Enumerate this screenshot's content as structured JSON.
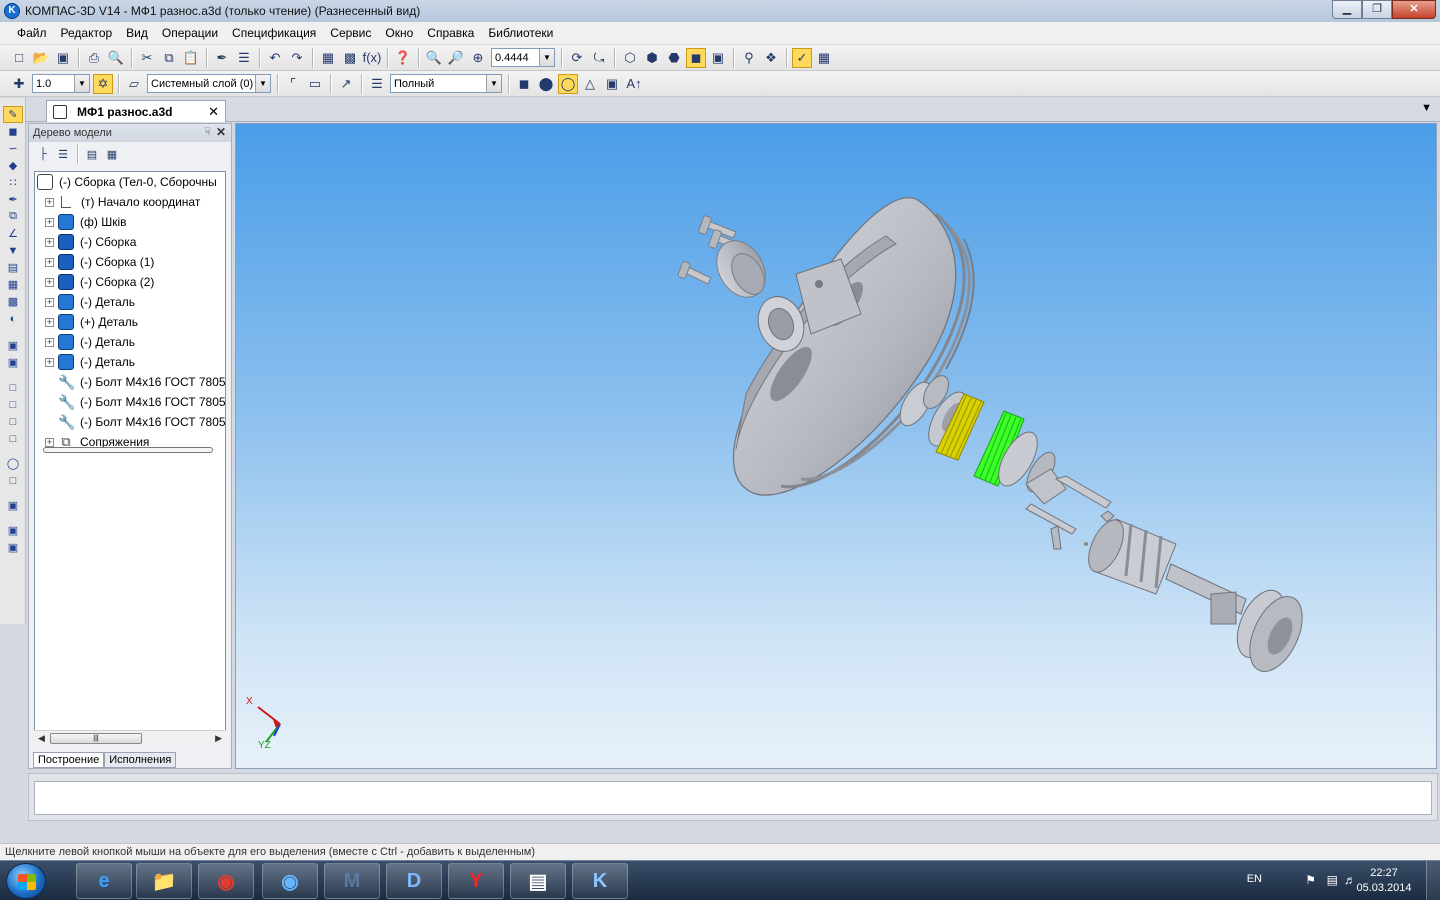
{
  "window": {
    "app_icon": "kompas-logo-icon",
    "title": "КОМПАС-3D V14 - МФ1 разнос.a3d (только чтение) (Разнесенный вид)",
    "controls": [
      "minimize-icon",
      "restore-icon",
      "close-icon"
    ]
  },
  "menubar": [
    "Файл",
    "Редактор",
    "Вид",
    "Операции",
    "Спецификация",
    "Сервис",
    "Окно",
    "Справка",
    "Библиотеки"
  ],
  "toolbar1": {
    "zoom_value": "0.4444"
  },
  "toolbar2": {
    "step_value": "1.0",
    "layer_value": "Системный слой (0)",
    "view_mode_value": "Полный"
  },
  "document_tab": {
    "label": "МФ1 разнос.a3d"
  },
  "model_tree": {
    "header": "Дерево модели",
    "items": [
      {
        "label": "(-) Сборка (Тел-0, Сборочны",
        "icon": "assembly-root-icon",
        "level": 0
      },
      {
        "label": "(т) Начало координат",
        "icon": "origin-icon",
        "level": 1
      },
      {
        "label": "(ф) Шків",
        "icon": "assembly-icon",
        "level": 1
      },
      {
        "label": "(-) Сборка",
        "icon": "assembly-icon",
        "level": 1
      },
      {
        "label": "(-) Сборка (1)",
        "icon": "assembly-icon",
        "level": 1
      },
      {
        "label": "(-) Сборка (2)",
        "icon": "assembly-icon",
        "level": 1
      },
      {
        "label": "(-) Деталь",
        "icon": "part-icon",
        "level": 1
      },
      {
        "label": "(+) Деталь",
        "icon": "part-icon",
        "level": 1
      },
      {
        "label": "(-) Деталь",
        "icon": "part-icon",
        "level": 1
      },
      {
        "label": "(-) Деталь",
        "icon": "part-icon",
        "level": 1
      },
      {
        "label": "(-) Болт М4х16 ГОСТ 7805",
        "icon": "bolt-icon",
        "level": 1
      },
      {
        "label": "(-) Болт М4х16 ГОСТ 7805",
        "icon": "bolt-icon",
        "level": 1
      },
      {
        "label": "(-) Болт М4х16 ГОСТ 7805",
        "icon": "bolt-icon",
        "level": 1
      },
      {
        "label": "Сопряжения",
        "icon": "mate-icon",
        "level": 1
      }
    ],
    "tabs": [
      "Построение",
      "Исполнения"
    ]
  },
  "viewport": {
    "axis_labels": {
      "x": "X",
      "yz": "YZ"
    },
    "colors": {
      "part_gray": "#b9bcc4",
      "yellow_part": "#d9d200",
      "green_part": "#3cff2a"
    }
  },
  "statusbar": {
    "text": "Щелкните левой кнопкой мыши на объекте для его выделения (вместе с Ctrl - добавить к выделенным)"
  },
  "taskbar": {
    "apps": [
      "internet-explorer-icon",
      "file-explorer-icon",
      "chrome-icon",
      "app-blue-icon",
      "mathcad-icon",
      "app-d-icon",
      "yandex-icon",
      "document-icon",
      "kompas-icon"
    ],
    "language": "EN",
    "time": "22:27",
    "date": "05.03.2014"
  }
}
